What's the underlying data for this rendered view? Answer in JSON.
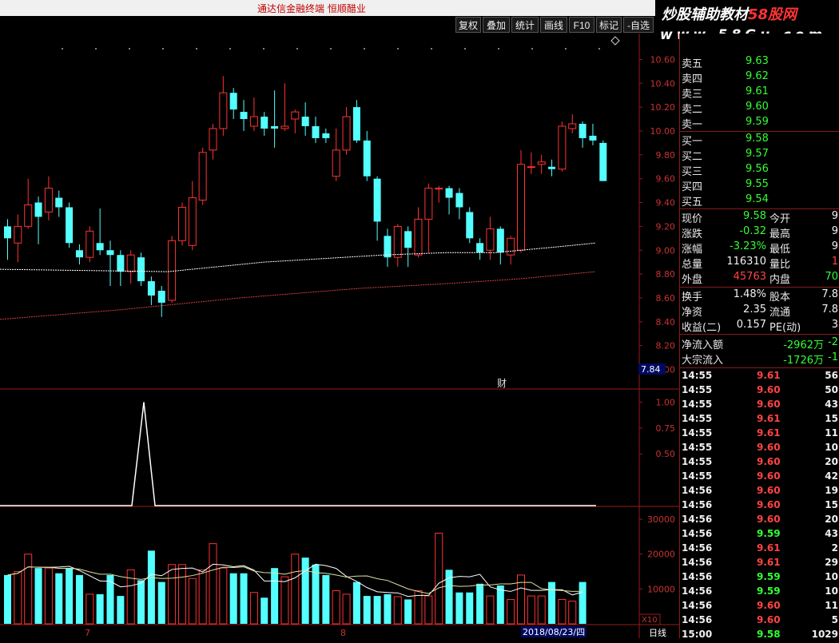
{
  "window": {
    "title": "通达信金融终端  恒顺醋业"
  },
  "toolbar": {
    "buttons": [
      "复权",
      "叠加",
      "统计",
      "画线",
      "F10",
      "标记",
      "-自选"
    ]
  },
  "watermark": {
    "line1_a": "炒股辅助教材",
    "line1_b": "58股网",
    "line2": "www.58Gu.com"
  },
  "chart_data": [
    {
      "type": "candlestick",
      "y_ticks": [
        "10.60",
        "10.40",
        "10.20",
        "10.00",
        "9.80",
        "9.60",
        "9.40",
        "9.20",
        "9.00",
        "8.80",
        "8.60",
        "8.40",
        "8.20",
        "8.00"
      ],
      "ylim": [
        7.95,
        10.75
      ],
      "last_label": "7.84",
      "marker": "财",
      "candles": [
        [
          9.2,
          9.1,
          9.26,
          8.92
        ],
        [
          9.06,
          9.2,
          9.3,
          8.9
        ],
        [
          9.2,
          9.38,
          9.6,
          9.18
        ],
        [
          9.4,
          9.28,
          9.45,
          9.05
        ],
        [
          9.32,
          9.52,
          9.62,
          9.25
        ],
        [
          9.44,
          9.36,
          9.5,
          9.28
        ],
        [
          9.36,
          9.06,
          9.4,
          9.02
        ],
        [
          9.0,
          8.94,
          9.05,
          8.88
        ],
        [
          8.94,
          9.16,
          9.2,
          8.9
        ],
        [
          9.06,
          9.0,
          9.35,
          8.96
        ],
        [
          9.0,
          8.96,
          9.08,
          8.7
        ],
        [
          8.96,
          8.82,
          9.0,
          8.7
        ],
        [
          8.82,
          8.96,
          9.0,
          8.72
        ],
        [
          8.94,
          8.74,
          8.98,
          8.7
        ],
        [
          8.74,
          8.62,
          8.78,
          8.54
        ],
        [
          8.66,
          8.56,
          8.7,
          8.44
        ],
        [
          8.58,
          9.08,
          9.12,
          8.56
        ],
        [
          9.08,
          9.36,
          9.4,
          9.04
        ],
        [
          9.04,
          9.44,
          9.58,
          9.0
        ],
        [
          9.42,
          9.82,
          9.86,
          9.38
        ],
        [
          9.84,
          10.02,
          10.06,
          9.76
        ],
        [
          10.02,
          10.32,
          10.46,
          9.96
        ],
        [
          10.32,
          10.18,
          10.36,
          10.1
        ],
        [
          10.16,
          10.1,
          10.26,
          10.0
        ],
        [
          10.04,
          10.12,
          10.28,
          10.0
        ],
        [
          10.12,
          10.02,
          10.16,
          9.96
        ],
        [
          10.04,
          10.02,
          10.34,
          9.86
        ],
        [
          10.02,
          10.04,
          10.4,
          10.0
        ],
        [
          10.1,
          10.16,
          10.18,
          9.98
        ],
        [
          10.12,
          10.04,
          10.24,
          9.96
        ],
        [
          10.04,
          9.94,
          10.12,
          9.9
        ],
        [
          9.98,
          9.94,
          10.02,
          9.9
        ],
        [
          9.62,
          9.84,
          10.02,
          9.58
        ],
        [
          9.84,
          10.12,
          10.2,
          9.8
        ],
        [
          10.2,
          9.92,
          10.26,
          9.9
        ],
        [
          9.92,
          9.62,
          10.0,
          9.58
        ],
        [
          9.6,
          9.24,
          9.62,
          9.08
        ],
        [
          9.12,
          8.94,
          9.18,
          8.86
        ],
        [
          8.94,
          9.2,
          9.22,
          8.86
        ],
        [
          9.16,
          9.02,
          9.2,
          8.86
        ],
        [
          8.96,
          9.26,
          9.36,
          8.94
        ],
        [
          9.26,
          9.52,
          9.56,
          8.98
        ],
        [
          9.52,
          9.52,
          9.54,
          9.4
        ],
        [
          9.52,
          9.44,
          9.54,
          9.3
        ],
        [
          9.48,
          9.36,
          9.52,
          9.26
        ],
        [
          9.32,
          9.1,
          9.36,
          9.06
        ],
        [
          9.06,
          8.98,
          9.1,
          8.92
        ],
        [
          9.0,
          9.18,
          9.28,
          8.92
        ],
        [
          9.18,
          8.98,
          9.2,
          8.88
        ],
        [
          8.96,
          9.1,
          9.12,
          8.88
        ],
        [
          9.0,
          9.72,
          9.84,
          8.98
        ],
        [
          9.7,
          9.7,
          9.82,
          9.64
        ],
        [
          9.72,
          9.74,
          9.8,
          9.64
        ],
        [
          9.7,
          9.68,
          9.76,
          9.62
        ],
        [
          9.68,
          10.04,
          10.08,
          9.66
        ],
        [
          10.02,
          10.06,
          10.14,
          9.98
        ],
        [
          10.06,
          9.94,
          10.08,
          9.86
        ],
        [
          9.96,
          9.92,
          10.06,
          9.88
        ],
        [
          9.9,
          9.58,
          9.92,
          9.58
        ]
      ],
      "ma_white": [
        [
          0,
          8.84
        ],
        [
          210,
          8.82
        ],
        [
          330,
          8.9
        ],
        [
          480,
          8.96
        ],
        [
          560,
          8.98
        ],
        [
          620,
          8.98
        ],
        [
          700,
          9.03
        ],
        [
          745,
          9.06
        ]
      ],
      "ma_red": [
        [
          0,
          8.42
        ],
        [
          150,
          8.5
        ],
        [
          300,
          8.6
        ],
        [
          450,
          8.68
        ],
        [
          560,
          8.72
        ],
        [
          650,
          8.76
        ],
        [
          745,
          8.82
        ]
      ]
    },
    {
      "type": "line",
      "y_ticks": [
        "1.00",
        "0.75",
        "0.50"
      ],
      "ylim": [
        0,
        1.05
      ]
    },
    {
      "type": "bar",
      "y_ticks": [
        "30000",
        "20000",
        "10000"
      ],
      "ylim": [
        0,
        33000
      ],
      "unit": "X10",
      "x_labels": [
        "7",
        "8"
      ],
      "date_label": "2018/08/23/四",
      "period_label": "日线"
    }
  ],
  "quote": {
    "sell": [
      {
        "label": "卖五",
        "price": "9.63"
      },
      {
        "label": "卖四",
        "price": "9.62"
      },
      {
        "label": "卖三",
        "price": "9.61"
      },
      {
        "label": "卖二",
        "price": "9.60"
      },
      {
        "label": "卖一",
        "price": "9.59"
      }
    ],
    "buy": [
      {
        "label": "买一",
        "price": "9.58"
      },
      {
        "label": "买二",
        "price": "9.57"
      },
      {
        "label": "买三",
        "price": "9.56"
      },
      {
        "label": "买四",
        "price": "9.55"
      },
      {
        "label": "买五",
        "price": "9.54"
      }
    ],
    "stats": [
      {
        "l1": "现价",
        "v1": "9.58",
        "l2": "今开",
        "v2": "9"
      },
      {
        "l1": "涨跌",
        "v1": "-0.32",
        "l2": "最高",
        "v2": "9"
      },
      {
        "l1": "涨幅",
        "v1": "-3.23%",
        "l2": "最低",
        "v2": "9"
      },
      {
        "l1": "总量",
        "v1": "116310",
        "l2": "量比",
        "v2": "1"
      },
      {
        "l1": "外盘",
        "v1": "45763",
        "l2": "内盘",
        "v2": "70"
      }
    ],
    "stats2": [
      {
        "l1": "换手",
        "v1": "1.48%",
        "l2": "股本",
        "v2": "7.8"
      },
      {
        "l1": "净资",
        "v1": "2.35",
        "l2": "流通",
        "v2": "7.8"
      },
      {
        "l1": "收益(二)",
        "v1": "0.157",
        "l2": "PE(动)",
        "v2": "3"
      }
    ],
    "flow": [
      {
        "label": "净流入额",
        "value": "-2962万",
        "extra": "-2"
      },
      {
        "label": "大宗流入",
        "value": "-1726万",
        "extra": "-1"
      }
    ]
  },
  "ticks": [
    {
      "t": "14:55",
      "p": "9.61",
      "v": "56"
    },
    {
      "t": "14:55",
      "p": "9.60",
      "v": "50"
    },
    {
      "t": "14:55",
      "p": "9.60",
      "v": "43"
    },
    {
      "t": "14:55",
      "p": "9.61",
      "v": "15"
    },
    {
      "t": "14:55",
      "p": "9.61",
      "v": "11"
    },
    {
      "t": "14:55",
      "p": "9.60",
      "v": "10"
    },
    {
      "t": "14:55",
      "p": "9.60",
      "v": "20"
    },
    {
      "t": "14:55",
      "p": "9.60",
      "v": "42"
    },
    {
      "t": "14:56",
      "p": "9.60",
      "v": "19"
    },
    {
      "t": "14:56",
      "p": "9.60",
      "v": "15"
    },
    {
      "t": "14:56",
      "p": "9.60",
      "v": "20"
    },
    {
      "t": "14:56",
      "p": "9.59",
      "v": "43"
    },
    {
      "t": "14:56",
      "p": "9.61",
      "v": "2"
    },
    {
      "t": "14:56",
      "p": "9.61",
      "v": "29"
    },
    {
      "t": "14:56",
      "p": "9.59",
      "v": "10"
    },
    {
      "t": "14:56",
      "p": "9.59",
      "v": "10"
    },
    {
      "t": "14:56",
      "p": "9.60",
      "v": "11"
    },
    {
      "t": "14:56",
      "p": "9.60",
      "v": "5"
    },
    {
      "t": "15:00",
      "p": "9.58",
      "v": "1029"
    }
  ]
}
